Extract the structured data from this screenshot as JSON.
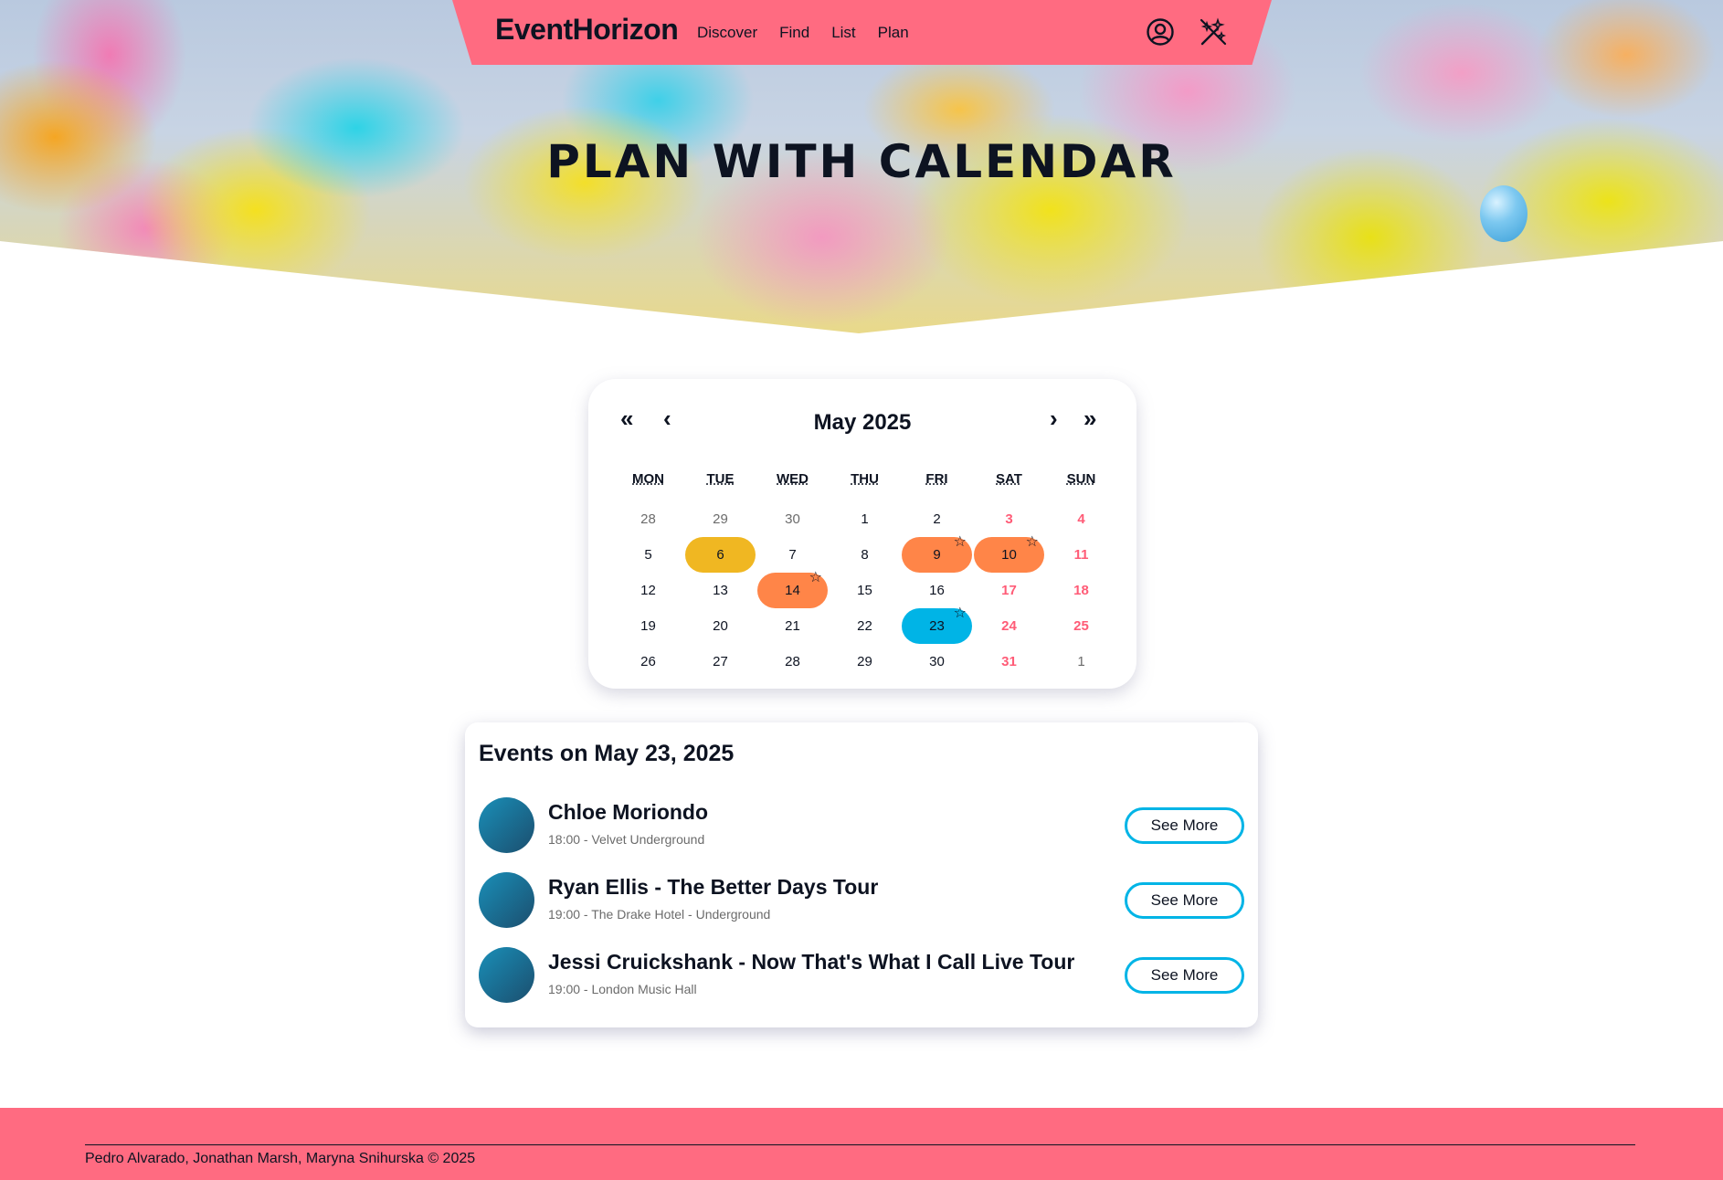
{
  "nav": {
    "brand": "EventHorizon",
    "links": [
      "Discover",
      "Find",
      "List",
      "Plan"
    ],
    "icons": [
      "user-circle-icon",
      "magic-wand-icon"
    ]
  },
  "hero": {
    "title": "PLAN WITH CALENDAR"
  },
  "calendar": {
    "month_label": "May 2025",
    "prev_year": "«",
    "prev_month": "‹",
    "next_month": "›",
    "next_year": "»",
    "weekdays": [
      "MON",
      "TUE",
      "WED",
      "THU",
      "FRI",
      "SAT",
      "SUN"
    ],
    "days": [
      {
        "d": "28",
        "muted": true
      },
      {
        "d": "29",
        "muted": true
      },
      {
        "d": "30",
        "muted": true
      },
      {
        "d": "1"
      },
      {
        "d": "2"
      },
      {
        "d": "3",
        "weekend": true
      },
      {
        "d": "4",
        "weekend": true
      },
      {
        "d": "5"
      },
      {
        "d": "6",
        "hl": "#f0b722"
      },
      {
        "d": "7"
      },
      {
        "d": "8"
      },
      {
        "d": "9",
        "hl": "#ff8548",
        "star": true
      },
      {
        "d": "10",
        "hl": "#ff8548",
        "star": true,
        "weekendHl": true
      },
      {
        "d": "11",
        "weekend": true
      },
      {
        "d": "12"
      },
      {
        "d": "13"
      },
      {
        "d": "14",
        "hl": "#ff8548",
        "star": true
      },
      {
        "d": "15"
      },
      {
        "d": "16"
      },
      {
        "d": "17",
        "weekend": true
      },
      {
        "d": "18",
        "weekend": true
      },
      {
        "d": "19"
      },
      {
        "d": "20"
      },
      {
        "d": "21"
      },
      {
        "d": "22"
      },
      {
        "d": "23",
        "hl": "#00b4e6",
        "star": true
      },
      {
        "d": "24",
        "weekend": true
      },
      {
        "d": "25",
        "weekend": true
      },
      {
        "d": "26"
      },
      {
        "d": "27"
      },
      {
        "d": "28"
      },
      {
        "d": "29"
      },
      {
        "d": "30"
      },
      {
        "d": "31",
        "weekend": true
      },
      {
        "d": "1",
        "muted": true
      }
    ],
    "colors": {
      "accent_yellow": "#f0b722",
      "accent_orange": "#ff8548",
      "accent_blue": "#00b4e6",
      "weekend": "#ff5c77"
    }
  },
  "events": {
    "title": "Events on May 23, 2025",
    "items": [
      {
        "name": "Chloe Moriondo",
        "meta": "18:00 - Velvet Underground",
        "button": "See More"
      },
      {
        "name": "Ryan Ellis - The Better Days Tour",
        "meta": "19:00 - The Drake Hotel - Underground",
        "button": "See More"
      },
      {
        "name": "Jessi Cruickshank - Now That's What I Call Live Tour",
        "meta": "19:00 - London Music Hall",
        "button": "See More"
      }
    ]
  },
  "footer": {
    "credits": "Pedro Alvarado, Jonathan Marsh, Maryna Snihurska © 2025"
  },
  "theme": {
    "primary": "#ff6b81",
    "text": "#0d1321"
  }
}
